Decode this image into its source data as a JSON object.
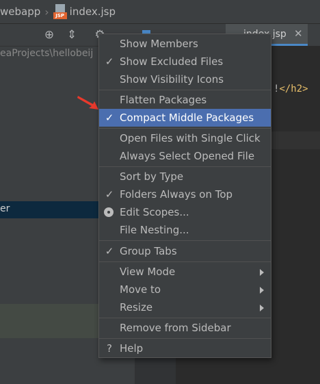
{
  "breadcrumb": {
    "folder": "webapp",
    "file": "index.jsp",
    "file_icon_tag": "JSP"
  },
  "project_panel": {
    "path_text": "eaProjects\\hellobeij",
    "selected_item_text": "er"
  },
  "editor": {
    "tab_label": "index.jsp",
    "code_fragment_bang": "!",
    "code_fragment_tag": "</h2>"
  },
  "menu": {
    "items": [
      {
        "label": "Show Members",
        "mark": ""
      },
      {
        "label": "Show Excluded Files",
        "mark": "✓"
      },
      {
        "label": "Show Visibility Icons",
        "mark": ""
      },
      {
        "label": "Flatten Packages",
        "mark": ""
      },
      {
        "label": "Compact Middle Packages",
        "mark": "✓"
      },
      {
        "label": "Open Files with Single Click",
        "mark": ""
      },
      {
        "label": "Always Select Opened File",
        "mark": ""
      },
      {
        "label": "Sort by Type",
        "mark": ""
      },
      {
        "label": "Folders Always on Top",
        "mark": "✓"
      },
      {
        "label": "Edit Scopes...",
        "mark": ""
      },
      {
        "label": "File Nesting...",
        "mark": ""
      },
      {
        "label": "Group Tabs",
        "mark": "✓"
      },
      {
        "label": "View Mode",
        "mark": ""
      },
      {
        "label": "Move to",
        "mark": ""
      },
      {
        "label": "Resize",
        "mark": ""
      },
      {
        "label": "Remove from Sidebar",
        "mark": ""
      },
      {
        "label": "Help",
        "mark": "?"
      }
    ]
  },
  "colors": {
    "menu_bg": "#3c3f41",
    "highlight": "#4b6eaf",
    "annotation_arrow": "#e8392c"
  }
}
